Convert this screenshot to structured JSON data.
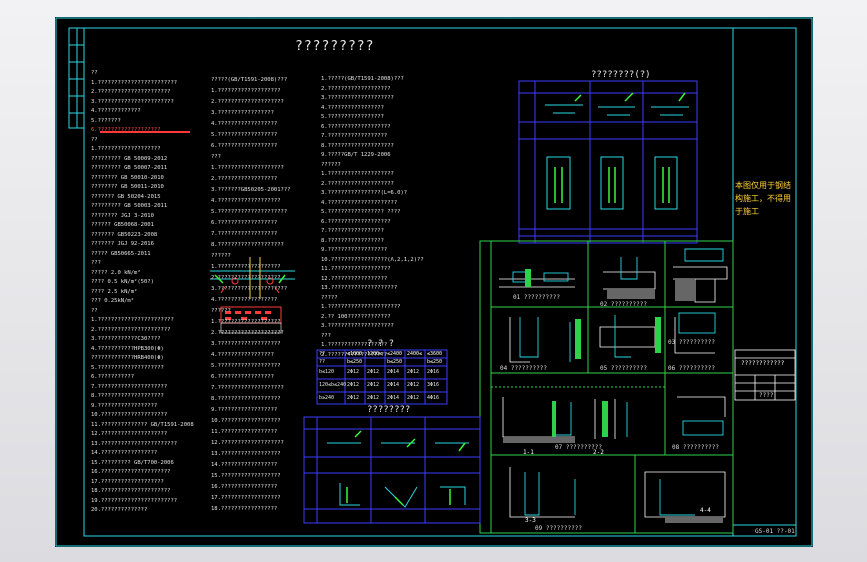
{
  "sheet": {
    "title": "?????????",
    "subtitle_a": "????????(?)",
    "subtitle_b": "? ? ?",
    "subtitle_c": "????????"
  },
  "yellow_note": "本图仅用于钢结构施工，不得用于施工",
  "title_block": {
    "project_name": "????????????",
    "sheet_no": "????",
    "footer": "GS-01  ??-01"
  },
  "table": {
    "header": [
      "??",
      "≤1000",
      "1200≤",
      "≤2400",
      "2400≤",
      "≤3600"
    ],
    "row2": [
      "??",
      "b≤250",
      "",
      "b≤250",
      "",
      "b≤250"
    ],
    "rows": [
      [
        "b≤120",
        "2Φ12",
        "2Φ12",
        "2Φ14",
        "2Φ12",
        "2Φ16"
      ],
      [
        "120≤b≤240",
        "2Φ12",
        "2Φ12",
        "2Φ14",
        "2Φ12",
        "3Φ16"
      ],
      [
        "b≥240",
        "2Φ12",
        "2Φ12",
        "2Φ14",
        "2Φ12",
        "4Φ16"
      ]
    ]
  },
  "sections": [
    "01 ??????????",
    "02 ??????????",
    "03 ??????????",
    "04 ??????????",
    "05 ??????????",
    "06 ??????????",
    "07 ??????????",
    "08 ??????????",
    "09 ??????????"
  ],
  "cuts": [
    "1-1",
    "2-2",
    "3-3",
    "4-4"
  ],
  "notes_col1": [
    "??",
    "1.????????????????????????",
    "2.??????????????????????",
    "3.???????????????????????",
    "4.?????????????",
    "5.???????",
    "6.???????????????????",
    "??",
    "1.???????????????????",
    "?????????    GB 50009-2012",
    "?????????    GB 50007-2011",
    "????????     GB 50010-2010",
    "????????     GB 50011-2010",
    "???????      GB 50204-2015",
    "?????????    GB 50003-2011",
    "????????     JGJ 3-2010",
    "??????       GB50068-2001",
    "???????      GB50223-2008",
    "???????      JGJ 92-2016",
    "?????        GB50665-2011",
    "???",
    "?????          2.0 kN/m²",
    "????           0.5 kN/m²(50?)",
    "????           2.5 kN/m²",
    "???            0.25kN/m²",
    "??",
    "1.???????????????????????",
    "2.??????????????????????",
    "3.????????????C30????",
    "4.???????????HPB300(Φ)",
    "  ?????????????HRB400(Φ)",
    "5.????????????????????",
    "6.???????????",
    "7.?????????????????????",
    "8.????????????????????",
    "9.??????????????????",
    "10.????????????????????",
    "11.?????????????? GB/T1591-2008",
    "12.????????????????????",
    "13.???????????????????????",
    "14.?????????????????",
    "15.????????? GB/T700-2006",
    "16.?????????????????????",
    "17.???????????????????",
    "18.?????????????????????",
    "19.???????????????????????",
    "20.??????????????"
  ],
  "notes_col2": [
    "?????(GB/T1591-2008)???",
    "1.???????????????????",
    "2.????????????????????",
    "3.?????????????????",
    "4.??????????????????",
    "5.??????????????????",
    "6.??????????????????",
    "???",
    "1.????????????????????",
    "2.??????????????????",
    "3.???????GB50205-2001???",
    "4.???????????????????",
    "5.?????????????????????",
    "6.??????????????????",
    "7.??????????????????",
    "8.????????????????????",
    "??????",
    "1.???????????????????",
    "2.???????????????????",
    "3.?????????????????????",
    "4.??????????????????",
    "??????",
    "1.???????????????????",
    "2.????????????????????",
    "3.???????????????????",
    "4.?????????????????",
    "5.???????????????????",
    "6.?????????????????",
    "7.????????????????????",
    "8.???????????????????",
    "9.??????????????????",
    "10.??????????????????",
    "11.?????????????????",
    "12.???????????????????",
    "13.??????????????????",
    "14.?????????????????",
    "15.??????????????????",
    "16.?????????????????",
    "17.??????????????????",
    "18.?????????????????"
  ],
  "notes_col3": [
    "1.?????(GB/T1591-2008)???",
    "2.???????????????????",
    "3.????????????????????",
    "4.?????????????????",
    "5.?????????????????",
    "6.???????????????????",
    "7.??????????????????",
    "8.????????????????????",
    "9.?????GB/T 1229-2006",
    "??????",
    "1.????????????????????",
    "2.????????????????????",
    "3.????????????????(L=6.0)?",
    "4.?????????????????????",
    "5.?????????????????   ????",
    "6.???????????????????",
    "7.?????????????????",
    "8.?????????????????",
    "9.??????????????????",
    "10.?????????????????(Λ,2,1,2)??",
    "11.??????????????????",
    "12.?????????????????",
    "13.????????????????????",
    "?????",
    "1.??????????????????????",
    "2.?? 100?????????????",
    "3.????????????????????",
    "???",
    "1.??????????????????",
    "2.??????????????????"
  ]
}
